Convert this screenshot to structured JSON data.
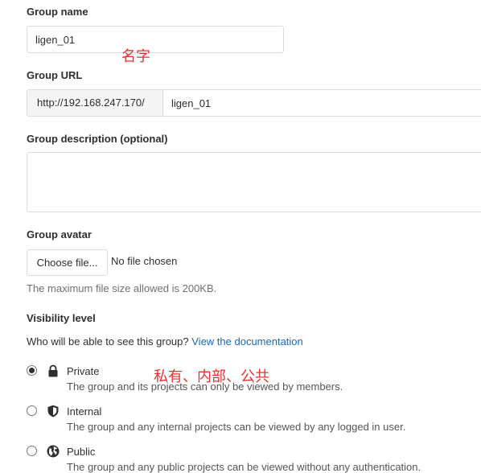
{
  "group_name": {
    "label": "Group name",
    "value": "ligen_01",
    "annotation": "名字"
  },
  "group_url": {
    "label": "Group URL",
    "prefix": "http://192.168.247.170/",
    "path_value": "ligen_01"
  },
  "group_description": {
    "label": "Group description (optional)",
    "value": ""
  },
  "group_avatar": {
    "label": "Group avatar",
    "choose_button": "Choose file...",
    "file_status": "No file chosen",
    "hint": "The maximum file size allowed is 200KB."
  },
  "visibility": {
    "label": "Visibility level",
    "question": "Who will be able to see this group?",
    "doc_link": "View the documentation",
    "annotation": "私有、内部、公共",
    "options": [
      {
        "title": "Private",
        "icon": "lock-icon",
        "selected": true,
        "description": "The group and its projects can only be viewed by members."
      },
      {
        "title": "Internal",
        "icon": "shield-icon",
        "selected": false,
        "description": "The group and any internal projects can be viewed by any logged in user."
      },
      {
        "title": "Public",
        "icon": "globe-icon",
        "selected": false,
        "description": "The group and any public projects can be viewed without any authentication."
      }
    ]
  },
  "colors": {
    "link": "#1b69b6",
    "annotation": "#e8302f",
    "border": "#dcdcdc"
  }
}
